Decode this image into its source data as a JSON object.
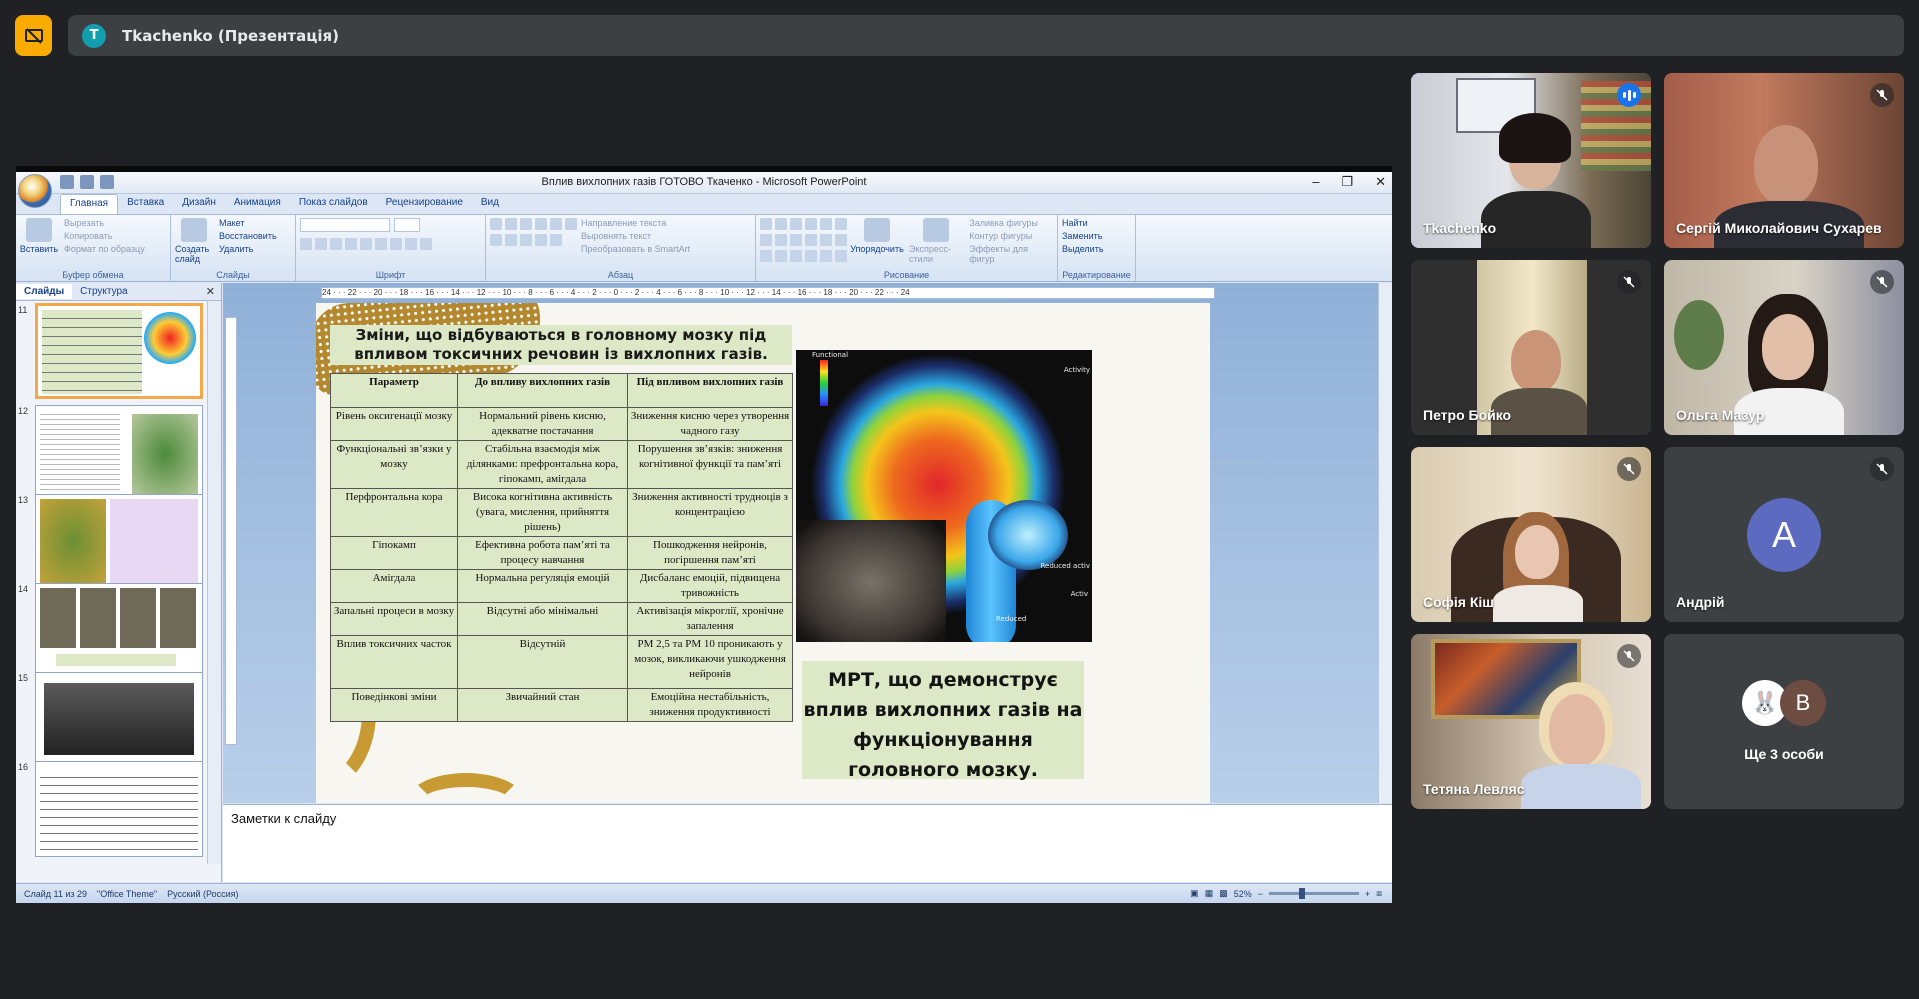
{
  "meet": {
    "presenter_initial": "T",
    "presentation_title": "Tkachenko (Презентація)"
  },
  "ppt": {
    "window_title": "Вплив вихлопних газів ГОТОВО Ткаченко - Microsoft PowerPoint",
    "tabs": [
      "Главная",
      "Вставка",
      "Дизайн",
      "Анимация",
      "Показ слайдов",
      "Рецензирование",
      "Вид"
    ],
    "ribbon": {
      "clipboard": {
        "paste": "Вставить",
        "cut": "Вырезать",
        "copy": "Копировать",
        "format_painter": "Формат по образцу",
        "label": "Буфер обмена"
      },
      "slides": {
        "new_slide": "Создать слайд",
        "layout": "Макет",
        "reset": "Восстановить",
        "delete": "Удалить",
        "label": "Слайды"
      },
      "font": {
        "label": "Шрифт"
      },
      "paragraph": {
        "text_direction": "Направление текста",
        "align_text": "Выровнять текст",
        "smartart": "Преобразовать в SmartArt",
        "label": "Абзац"
      },
      "drawing": {
        "arrange": "Упорядочить",
        "quick_styles": "Экспресс-стили",
        "shape_fill": "Заливка фигуры",
        "shape_outline": "Контур фигуры",
        "shape_effects": "Эффекты для фигур",
        "label": "Рисование"
      },
      "editing": {
        "find": "Найти",
        "replace": "Заменить",
        "select": "Выделить",
        "label": "Редактирование"
      }
    },
    "left_pane": {
      "tab_slides": "Слайды",
      "tab_outline": "Структура",
      "close": "✕",
      "slide_numbers": [
        "11",
        "12",
        "13",
        "14",
        "15",
        "16"
      ],
      "selected_slide": "11"
    },
    "ruler_text": "24 · · · 22 · · · 20 · · · 18 · · · 16 · · · 14 · · · 12 · · · 10 · · · 8 · · · 6 · · · 4 · · · 2 · · · 0 · · · 2 · · · 4 · · · 6 · · · 8 · · · 10 · · · 12 · · · 14 · · · 16 · · · 18 · · · 20 · · · 22 · · · 24",
    "slide": {
      "heading": "Зміни, що відбуваються в головному мозку під впливом токсичних речовин із вихлопних газів.",
      "table": {
        "headers": [
          "Параметр",
          "До впливу вихлопних газів",
          "Під впливом вихлопних газів"
        ],
        "rows": [
          [
            "Рівень оксигенації мозку",
            "Нормальний рівень кисню, адекватне постачання",
            "Зниження кисню через утворення чадного газу"
          ],
          [
            "Функціональні зв’язки у мозку",
            "Стабільна взаємодія між ділянками: префронтальна кора, гіпокамп, амігдала",
            "Порушення зв’язків: зниження когнітивної функції та пам’яті"
          ],
          [
            "Перфронтальна кора",
            "Висока когнітивна активність (увага, мислення, прийняття рішень)",
            "Зниження активності трудноців з концентрацією"
          ],
          [
            "Гіпокамп",
            "Ефективна робота пам’яті та процесу навчання",
            "Пошкодження нейронів, погіршення пам’яті"
          ],
          [
            "Амігдала",
            "Нормальна регуляція емоцій",
            "Дисбаланс емоцій, підвищена тривожність"
          ],
          [
            "Запальні процеси в мозку",
            "Відсутні або мінімальні",
            "Активізація мікроглії, хронічне запалення"
          ],
          [
            "Вплив токсичних часток",
            "Відсутній",
            "PM 2,5 та PM 10 проникають у мозок, викликаючи ушкодження нейронів"
          ],
          [
            "Поведінкові зміни",
            "Звичайний стан",
            "Емоційна нестабільність, зниження продуктивності"
          ]
        ]
      },
      "mri_labels": {
        "functional": "Functional",
        "activity": "Activity",
        "reduced_activ": "Reduced activ",
        "activ": "Activ",
        "reduced": "Reduced"
      },
      "caption": "МРТ, що демонструє вплив вихлопних газів на функціонування головного мозку."
    },
    "notes_placeholder": "Заметки к слайду",
    "status": {
      "slide_counter": "Слайд 11 из 29",
      "theme": "\"Office Theme\"",
      "language": "Русский (Россия)",
      "zoom": "52%"
    }
  },
  "participants": [
    {
      "name": "Tkachenko",
      "speaking": true
    },
    {
      "name": "Сергій Миколайович Сухарев",
      "muted": true
    },
    {
      "name": "Петро Бойко",
      "muted": true
    },
    {
      "name": "Ольга Мазур",
      "muted": true
    },
    {
      "name": "Софія Кіш",
      "muted": true
    },
    {
      "name": "Андрій",
      "initial": "А",
      "muted": true
    },
    {
      "name": "Тетяна Левляс",
      "muted": true
    },
    {
      "more_label": "Ще 3 особи",
      "more_initial": "В"
    }
  ],
  "colors": {
    "meet_bg": "#202124",
    "tile_bg": "#3c4043",
    "present_icon": "#f9ab00",
    "active_outline": "#8ab4f8",
    "slide_table_fill": "#dde8c6",
    "slide_gold": "#c79a33",
    "avatar_andrii": "#5c6bc0"
  }
}
